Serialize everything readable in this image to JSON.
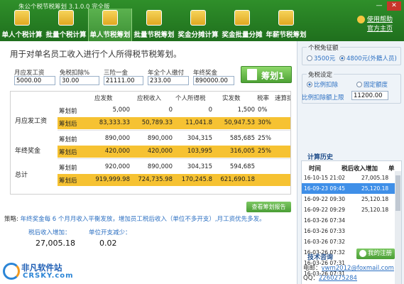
{
  "window": {
    "title": "朱公个税节税筹划 3.1.0.0 完全版",
    "min_label": "—",
    "close_label": "✕"
  },
  "toolbar": {
    "items": [
      {
        "label": "单人个税计算",
        "icon": "calculator-icon"
      },
      {
        "label": "批量个税计算",
        "icon": "calculator-stack-icon"
      },
      {
        "label": "单人节税筹划",
        "icon": "person-plan-icon"
      },
      {
        "label": "批量节税筹划",
        "icon": "batch-plan-icon"
      },
      {
        "label": "奖金分摊计算",
        "icon": "bonus-calc-icon"
      },
      {
        "label": "奖金批量分摊",
        "icon": "bonus-batch-icon"
      },
      {
        "label": "年薪节税筹划",
        "icon": "salary-money-icon"
      }
    ],
    "active_index": 2,
    "links": {
      "help": "使用帮助",
      "website": "官方主页"
    }
  },
  "main": {
    "headline": "用于对单名员工收入进行个人所得税节税筹划。",
    "fields": [
      {
        "label": "月应发工资",
        "value": "5000.00"
      },
      {
        "label": "免税扣除%",
        "value": "30.00"
      },
      {
        "label": "三险一金",
        "value": "21111.00"
      },
      {
        "label": "年全个人缴付",
        "value": "233.00"
      },
      {
        "label": "年终奖金",
        "value": "890000.00"
      }
    ],
    "calc_button": "筹划1",
    "table": {
      "columns": [
        "应发数",
        "应税收入",
        "个人所得税",
        "实发数",
        "税率",
        "速算扣"
      ],
      "groups": [
        {
          "label": "月应发工资",
          "rows": [
            {
              "tag": "筹划前",
              "values": [
                "5,000",
                "0",
                "0",
                "1,500",
                "0%"
              ]
            },
            {
              "tag": "筹划后",
              "values": [
                "83,333.33",
                "50,789.33",
                "11,041.8",
                "50,947.53",
                "30%"
              ]
            }
          ]
        },
        {
          "label": "年终奖金",
          "rows": [
            {
              "tag": "筹划前",
              "values": [
                "890,000",
                "890,000",
                "304,315",
                "585,685",
                "25%"
              ]
            },
            {
              "tag": "筹划后",
              "values": [
                "420,000",
                "420,000",
                "103,995",
                "316,005",
                "25%"
              ]
            }
          ]
        },
        {
          "label": "总计",
          "rows": [
            {
              "tag": "筹划前",
              "values": [
                "920,000",
                "890,000",
                "304,315",
                "594,685",
                ""
              ]
            },
            {
              "tag": "筹划后",
              "values": [
                "919,999.98",
                "724,735.98",
                "170,245.8",
                "621,690.18",
                ""
              ]
            }
          ]
        }
      ]
    },
    "report_button": "查看筹划报告",
    "strategy_prefix": "策略:",
    "strategy_text": "年终奖金每 6 个月月收入平衡发放，增加员工税后收入（单位不多开支）,月工资优先多发。",
    "result_labels": [
      "税后收入增加：",
      "单位开支减少："
    ],
    "result_values": [
      "27,005.18",
      "0.02"
    ],
    "logo": {
      "line1": "非凡软件站",
      "line2": "CRSKY.com"
    }
  },
  "right": {
    "exempt": {
      "legend": "个税免征额",
      "options": [
        "3500元",
        "4800元(外籍人员)"
      ],
      "selected": 1
    },
    "deduction": {
      "legend": "免税设定",
      "options": [
        "比例扣除",
        "固定额度"
      ],
      "selected": 0,
      "limit_label": "比例扣除额上限",
      "limit_value": "11200.00"
    },
    "history": {
      "title": "计算历史",
      "columns": [
        "时间",
        "税后收入增加",
        "单"
      ],
      "rows": [
        {
          "time": "16-10-15 21:02",
          "value": "27,005.18"
        },
        {
          "time": "16-09-23 09:45",
          "value": "25,120.18"
        },
        {
          "time": "16-09-22 09:30",
          "value": "25,120.18"
        },
        {
          "time": "16-09-22 09:29",
          "value": "25,120.18"
        },
        {
          "time": "16-03-26 07:34",
          "value": ""
        },
        {
          "time": "16-03-26 07:33",
          "value": ""
        },
        {
          "time": "16-03-26 07:32",
          "value": ""
        },
        {
          "time": "16-03-26 07:32",
          "value": ""
        },
        {
          "time": "16-03-26 07:31",
          "value": ""
        },
        {
          "time": "16-03-26 07:31",
          "value": ""
        }
      ],
      "selected": 1
    },
    "contact": {
      "title": "技术咨询",
      "register_button": "我的注册",
      "email_label": "电邮：",
      "email": "ywm2012@foxmail.com",
      "qq_label": "QQ：",
      "qq": "2260275284"
    }
  },
  "colors": {
    "toolbar_green": "#2f8f2a",
    "highlight_yellow": "#f6c232",
    "link_blue": "#2b6fc2",
    "selection_blue": "#3f8fe8"
  }
}
